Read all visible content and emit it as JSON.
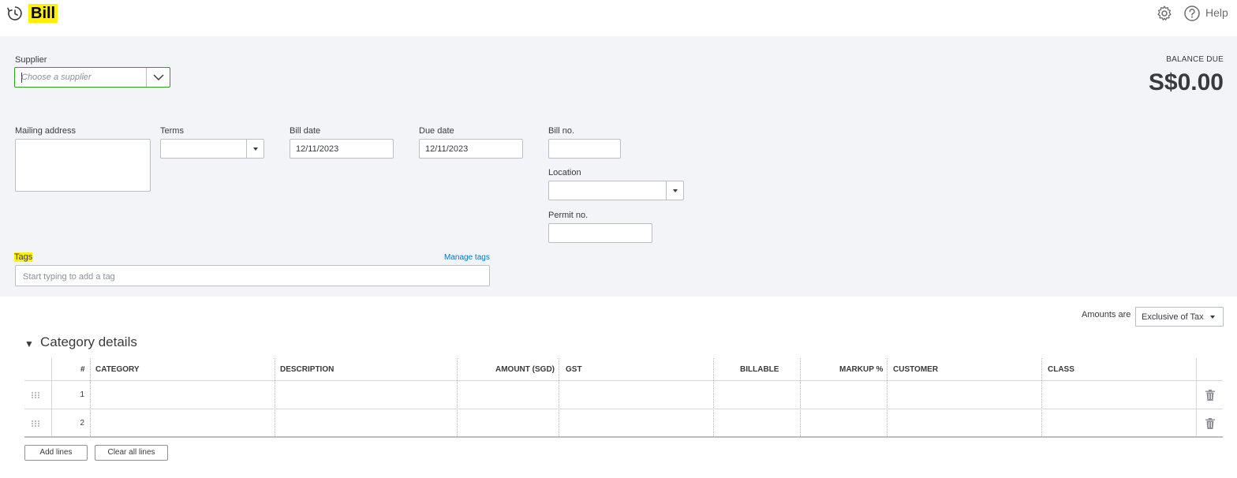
{
  "header": {
    "title": "Bill",
    "help_label": "Help"
  },
  "form": {
    "supplier_label": "Supplier",
    "supplier_placeholder": "Choose a supplier",
    "balance_due_label": "BALANCE DUE",
    "balance_due_value": "S$0.00",
    "mailing_address_label": "Mailing address",
    "terms_label": "Terms",
    "bill_date_label": "Bill date",
    "bill_date_value": "12/11/2023",
    "due_date_label": "Due date",
    "due_date_value": "12/11/2023",
    "bill_no_label": "Bill no.",
    "location_label": "Location",
    "permit_no_label": "Permit no.",
    "tags_label": "Tags",
    "manage_tags_label": "Manage tags",
    "tags_placeholder": "Start typing to add a tag"
  },
  "amounts": {
    "label": "Amounts are",
    "selected": "Exclusive of Tax"
  },
  "category_section": {
    "toggle": "▼",
    "title": "Category details",
    "columns": [
      "#",
      "CATEGORY",
      "DESCRIPTION",
      "AMOUNT (SGD)",
      "GST",
      "BILLABLE",
      "MARKUP %",
      "CUSTOMER",
      "CLASS"
    ],
    "rows": [
      "1",
      "2"
    ]
  },
  "buttons": {
    "add_lines": "Add lines",
    "clear_all_lines": "Clear all lines"
  },
  "colors": {
    "highlight": "#fff200",
    "brand_green": "#2ca01c",
    "link_blue": "#0077c5",
    "form_bg": "#f3f4f7"
  }
}
